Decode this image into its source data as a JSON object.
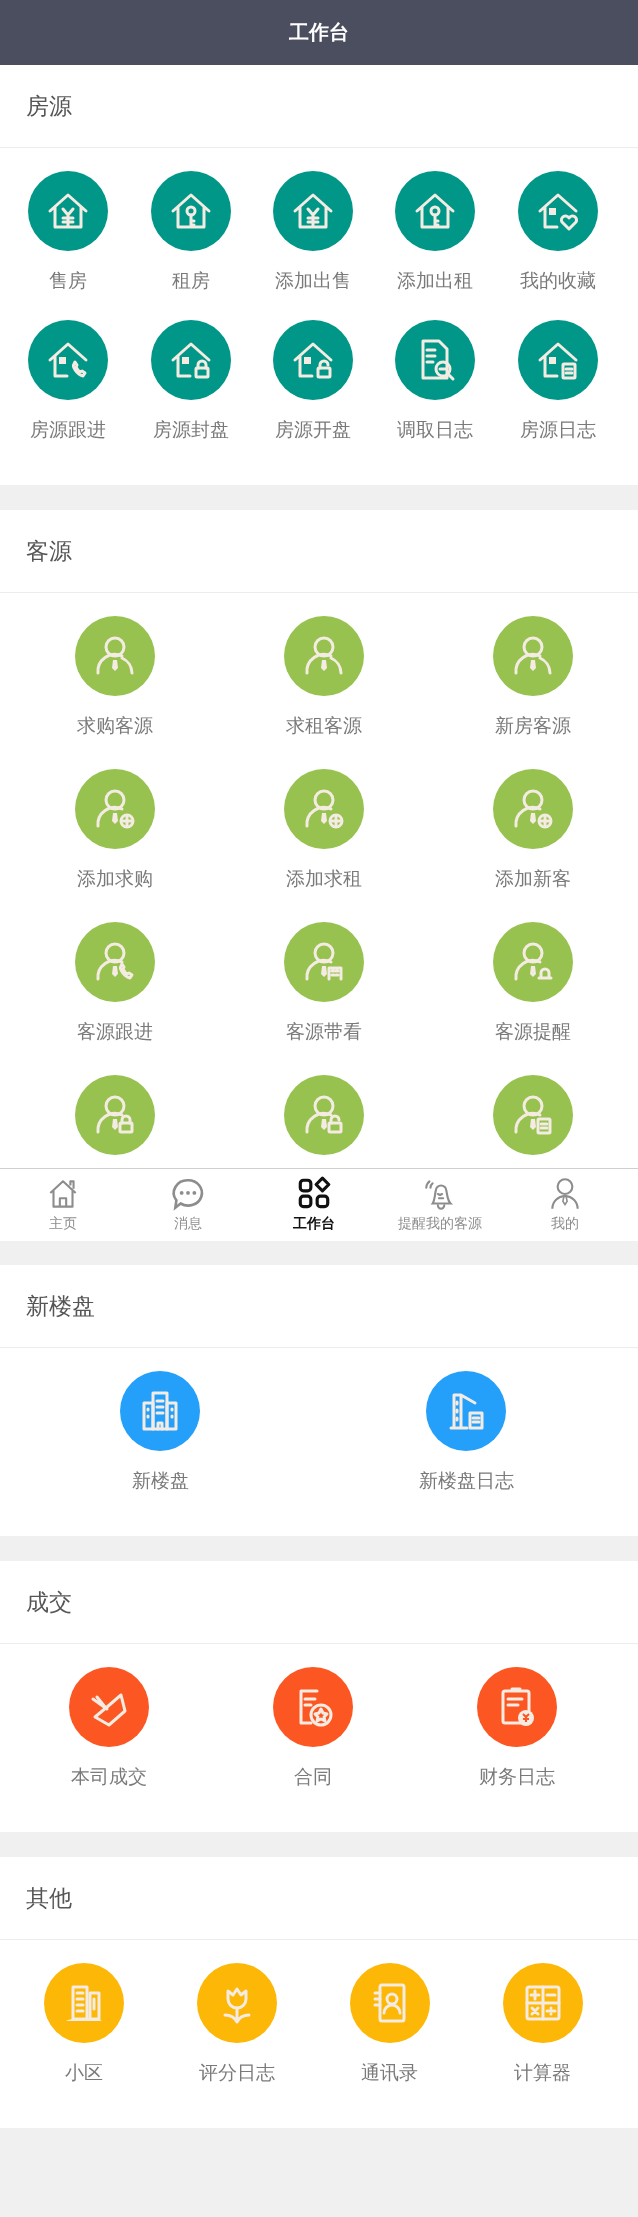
{
  "header": {
    "title": "工作台"
  },
  "sections": [
    {
      "kind": "house",
      "title": "房源",
      "items": [
        {
          "label": "售房"
        },
        {
          "label": "租房"
        },
        {
          "label": "添加出售"
        },
        {
          "label": "添加出租"
        },
        {
          "label": "我的收藏"
        },
        {
          "label": "房源跟进"
        },
        {
          "label": "房源封盘"
        },
        {
          "label": "房源开盘"
        },
        {
          "label": "调取日志"
        },
        {
          "label": "房源日志"
        }
      ]
    },
    {
      "kind": "customer",
      "title": "客源",
      "items": [
        {
          "label": "求购客源"
        },
        {
          "label": "求租客源"
        },
        {
          "label": "新房客源"
        },
        {
          "label": "添加求购"
        },
        {
          "label": "添加求租"
        },
        {
          "label": "添加新客"
        },
        {
          "label": "客源跟进"
        },
        {
          "label": "客源带看"
        },
        {
          "label": "客源提醒"
        },
        {
          "kind": "icon_only"
        },
        {
          "kind": "icon_only"
        },
        {
          "kind": "icon_only"
        }
      ]
    },
    {
      "kind": "building",
      "title": "新楼盘",
      "items": [
        {
          "label": "新楼盘"
        },
        {
          "label": "新楼盘日志"
        }
      ]
    },
    {
      "kind": "deal",
      "title": "成交",
      "items": [
        {
          "label": "本司成交"
        },
        {
          "label": "合同"
        },
        {
          "label": "财务日志"
        }
      ]
    },
    {
      "kind": "other",
      "title": "其他",
      "items": [
        {
          "label": "小区"
        },
        {
          "label": "评分日志"
        },
        {
          "label": "通讯录"
        },
        {
          "label": "计算器"
        }
      ]
    }
  ],
  "tabs": [
    {
      "label": "主页",
      "selected": false
    },
    {
      "label": "消息",
      "selected": false
    },
    {
      "label": "工作台",
      "selected": true
    },
    {
      "label": "提醒我的客源",
      "selected": false
    },
    {
      "label": "我的",
      "selected": false
    }
  ]
}
